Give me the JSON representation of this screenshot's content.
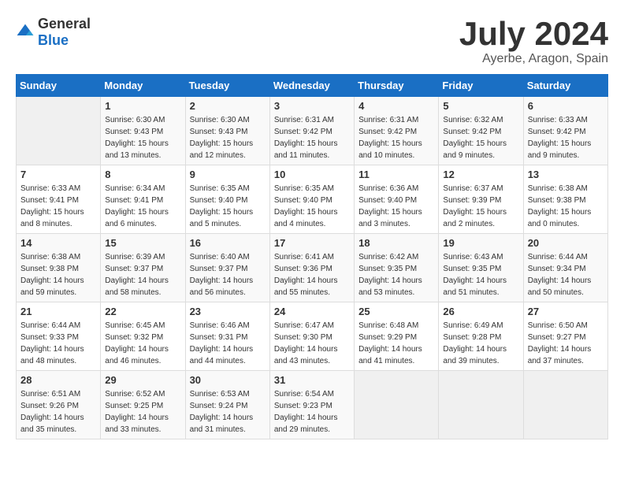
{
  "logo": {
    "general": "General",
    "blue": "Blue"
  },
  "title": "July 2024",
  "location": "Ayerbe, Aragon, Spain",
  "days_header": [
    "Sunday",
    "Monday",
    "Tuesday",
    "Wednesday",
    "Thursday",
    "Friday",
    "Saturday"
  ],
  "weeks": [
    [
      {
        "day": "",
        "sunrise": "",
        "sunset": "",
        "daylight": ""
      },
      {
        "day": "1",
        "sunrise": "Sunrise: 6:30 AM",
        "sunset": "Sunset: 9:43 PM",
        "daylight": "Daylight: 15 hours and 13 minutes."
      },
      {
        "day": "2",
        "sunrise": "Sunrise: 6:30 AM",
        "sunset": "Sunset: 9:43 PM",
        "daylight": "Daylight: 15 hours and 12 minutes."
      },
      {
        "day": "3",
        "sunrise": "Sunrise: 6:31 AM",
        "sunset": "Sunset: 9:42 PM",
        "daylight": "Daylight: 15 hours and 11 minutes."
      },
      {
        "day": "4",
        "sunrise": "Sunrise: 6:31 AM",
        "sunset": "Sunset: 9:42 PM",
        "daylight": "Daylight: 15 hours and 10 minutes."
      },
      {
        "day": "5",
        "sunrise": "Sunrise: 6:32 AM",
        "sunset": "Sunset: 9:42 PM",
        "daylight": "Daylight: 15 hours and 9 minutes."
      },
      {
        "day": "6",
        "sunrise": "Sunrise: 6:33 AM",
        "sunset": "Sunset: 9:42 PM",
        "daylight": "Daylight: 15 hours and 9 minutes."
      }
    ],
    [
      {
        "day": "7",
        "sunrise": "Sunrise: 6:33 AM",
        "sunset": "Sunset: 9:41 PM",
        "daylight": "Daylight: 15 hours and 8 minutes."
      },
      {
        "day": "8",
        "sunrise": "Sunrise: 6:34 AM",
        "sunset": "Sunset: 9:41 PM",
        "daylight": "Daylight: 15 hours and 6 minutes."
      },
      {
        "day": "9",
        "sunrise": "Sunrise: 6:35 AM",
        "sunset": "Sunset: 9:40 PM",
        "daylight": "Daylight: 15 hours and 5 minutes."
      },
      {
        "day": "10",
        "sunrise": "Sunrise: 6:35 AM",
        "sunset": "Sunset: 9:40 PM",
        "daylight": "Daylight: 15 hours and 4 minutes."
      },
      {
        "day": "11",
        "sunrise": "Sunrise: 6:36 AM",
        "sunset": "Sunset: 9:40 PM",
        "daylight": "Daylight: 15 hours and 3 minutes."
      },
      {
        "day": "12",
        "sunrise": "Sunrise: 6:37 AM",
        "sunset": "Sunset: 9:39 PM",
        "daylight": "Daylight: 15 hours and 2 minutes."
      },
      {
        "day": "13",
        "sunrise": "Sunrise: 6:38 AM",
        "sunset": "Sunset: 9:38 PM",
        "daylight": "Daylight: 15 hours and 0 minutes."
      }
    ],
    [
      {
        "day": "14",
        "sunrise": "Sunrise: 6:38 AM",
        "sunset": "Sunset: 9:38 PM",
        "daylight": "Daylight: 14 hours and 59 minutes."
      },
      {
        "day": "15",
        "sunrise": "Sunrise: 6:39 AM",
        "sunset": "Sunset: 9:37 PM",
        "daylight": "Daylight: 14 hours and 58 minutes."
      },
      {
        "day": "16",
        "sunrise": "Sunrise: 6:40 AM",
        "sunset": "Sunset: 9:37 PM",
        "daylight": "Daylight: 14 hours and 56 minutes."
      },
      {
        "day": "17",
        "sunrise": "Sunrise: 6:41 AM",
        "sunset": "Sunset: 9:36 PM",
        "daylight": "Daylight: 14 hours and 55 minutes."
      },
      {
        "day": "18",
        "sunrise": "Sunrise: 6:42 AM",
        "sunset": "Sunset: 9:35 PM",
        "daylight": "Daylight: 14 hours and 53 minutes."
      },
      {
        "day": "19",
        "sunrise": "Sunrise: 6:43 AM",
        "sunset": "Sunset: 9:35 PM",
        "daylight": "Daylight: 14 hours and 51 minutes."
      },
      {
        "day": "20",
        "sunrise": "Sunrise: 6:44 AM",
        "sunset": "Sunset: 9:34 PM",
        "daylight": "Daylight: 14 hours and 50 minutes."
      }
    ],
    [
      {
        "day": "21",
        "sunrise": "Sunrise: 6:44 AM",
        "sunset": "Sunset: 9:33 PM",
        "daylight": "Daylight: 14 hours and 48 minutes."
      },
      {
        "day": "22",
        "sunrise": "Sunrise: 6:45 AM",
        "sunset": "Sunset: 9:32 PM",
        "daylight": "Daylight: 14 hours and 46 minutes."
      },
      {
        "day": "23",
        "sunrise": "Sunrise: 6:46 AM",
        "sunset": "Sunset: 9:31 PM",
        "daylight": "Daylight: 14 hours and 44 minutes."
      },
      {
        "day": "24",
        "sunrise": "Sunrise: 6:47 AM",
        "sunset": "Sunset: 9:30 PM",
        "daylight": "Daylight: 14 hours and 43 minutes."
      },
      {
        "day": "25",
        "sunrise": "Sunrise: 6:48 AM",
        "sunset": "Sunset: 9:29 PM",
        "daylight": "Daylight: 14 hours and 41 minutes."
      },
      {
        "day": "26",
        "sunrise": "Sunrise: 6:49 AM",
        "sunset": "Sunset: 9:28 PM",
        "daylight": "Daylight: 14 hours and 39 minutes."
      },
      {
        "day": "27",
        "sunrise": "Sunrise: 6:50 AM",
        "sunset": "Sunset: 9:27 PM",
        "daylight": "Daylight: 14 hours and 37 minutes."
      }
    ],
    [
      {
        "day": "28",
        "sunrise": "Sunrise: 6:51 AM",
        "sunset": "Sunset: 9:26 PM",
        "daylight": "Daylight: 14 hours and 35 minutes."
      },
      {
        "day": "29",
        "sunrise": "Sunrise: 6:52 AM",
        "sunset": "Sunset: 9:25 PM",
        "daylight": "Daylight: 14 hours and 33 minutes."
      },
      {
        "day": "30",
        "sunrise": "Sunrise: 6:53 AM",
        "sunset": "Sunset: 9:24 PM",
        "daylight": "Daylight: 14 hours and 31 minutes."
      },
      {
        "day": "31",
        "sunrise": "Sunrise: 6:54 AM",
        "sunset": "Sunset: 9:23 PM",
        "daylight": "Daylight: 14 hours and 29 minutes."
      },
      {
        "day": "",
        "sunrise": "",
        "sunset": "",
        "daylight": ""
      },
      {
        "day": "",
        "sunrise": "",
        "sunset": "",
        "daylight": ""
      },
      {
        "day": "",
        "sunrise": "",
        "sunset": "",
        "daylight": ""
      }
    ]
  ]
}
